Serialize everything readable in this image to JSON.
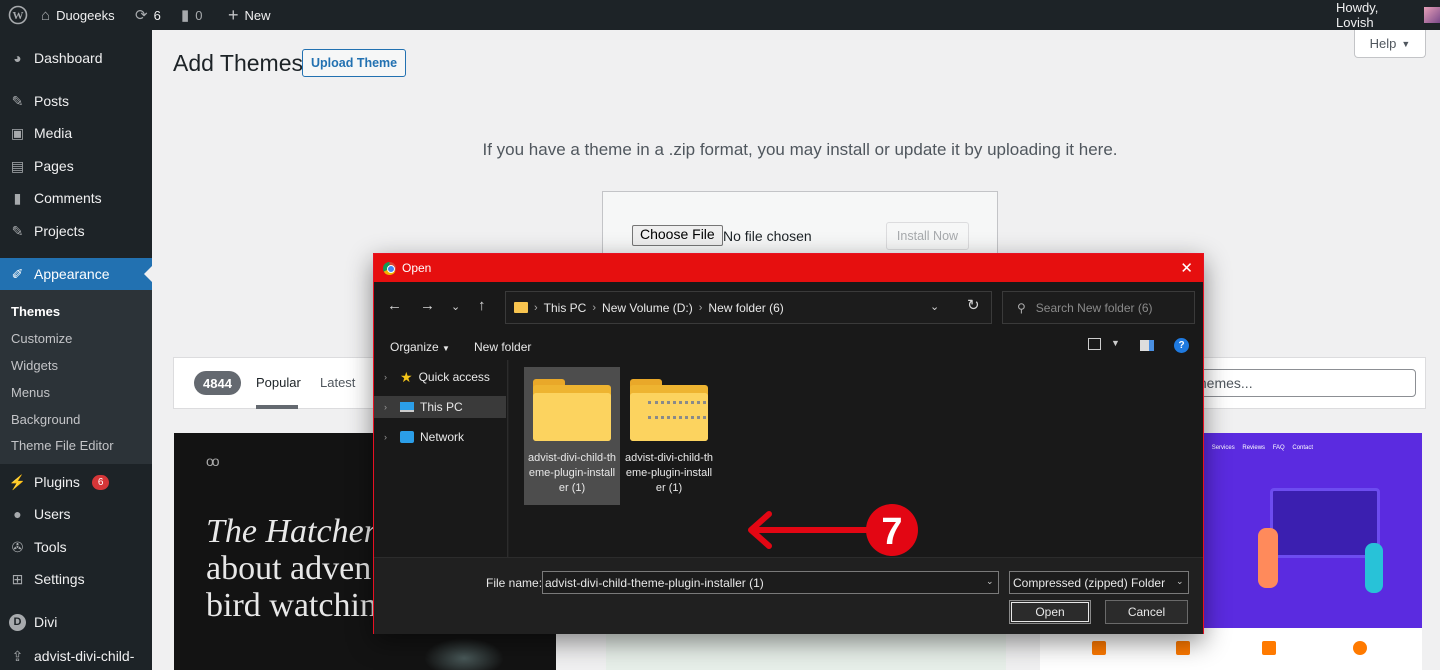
{
  "adminbar": {
    "site_name": "Duogeeks",
    "updates_count": "6",
    "comments_count": "0",
    "new_label": "New",
    "howdy": "Howdy, Lovish"
  },
  "sidebar": {
    "items": [
      {
        "label": "Dashboard",
        "icon": "dashboard-icon"
      },
      {
        "label": "Posts",
        "icon": "pin-icon"
      },
      {
        "label": "Media",
        "icon": "media-icon"
      },
      {
        "label": "Pages",
        "icon": "page-icon"
      },
      {
        "label": "Comments",
        "icon": "comment-icon"
      },
      {
        "label": "Projects",
        "icon": "pin-icon"
      },
      {
        "label": "Appearance",
        "icon": "brush-icon"
      },
      {
        "label": "Plugins",
        "icon": "plugin-icon",
        "badge": "6"
      },
      {
        "label": "Users",
        "icon": "user-icon"
      },
      {
        "label": "Tools",
        "icon": "wrench-icon"
      },
      {
        "label": "Settings",
        "icon": "settings-icon"
      },
      {
        "label": "Divi",
        "icon": "divi-icon"
      },
      {
        "label": "advist-divi-child-",
        "icon": "upload-icon"
      }
    ],
    "submenu": [
      "Themes",
      "Customize",
      "Widgets",
      "Menus",
      "Background",
      "Theme File Editor"
    ]
  },
  "main": {
    "title": "Add Themes",
    "upload_button": "Upload Theme",
    "help": "Help",
    "upload_description": "If you have a theme in a .zip format, you may install or update it by uploading it here.",
    "choose_file": "Choose File",
    "no_file": "No file chosen",
    "install_now": "Install Now"
  },
  "filter": {
    "count": "4844",
    "tab_popular": "Popular",
    "tab_latest": "Latest",
    "search_placeholder": "themes..."
  },
  "cards": {
    "card1_logo": "oo",
    "card1_line1": "The Hatchery",
    "card1_line2": "about adven",
    "card1_line3": "bird watchin",
    "card3_nav": "Home About Services Reviews FAQ Contact"
  },
  "dialog": {
    "title": "Open",
    "breadcrumb": [
      "This PC",
      "New Volume (D:)",
      "New folder (6)"
    ],
    "search_placeholder": "Search New folder (6)",
    "organize": "Organize",
    "new_folder": "New folder",
    "nav_items": [
      "Quick access",
      "This PC",
      "Network"
    ],
    "files": [
      {
        "name": "advist-divi-child-theme-plugin-installer (1)",
        "type": "folder"
      },
      {
        "name": "advist-divi-child-theme-plugin-installer (1)",
        "type": "zip-folder"
      }
    ],
    "annotation_number": "7",
    "file_name_label": "File name:",
    "file_name_value": "advist-divi-child-theme-plugin-installer (1)",
    "file_type": "Compressed (zipped) Folder",
    "open_button": "Open",
    "cancel_button": "Cancel",
    "colors": {
      "titlebar": "#e60f0f",
      "annotation": "#e30613",
      "folder": "#fcd35f"
    }
  }
}
